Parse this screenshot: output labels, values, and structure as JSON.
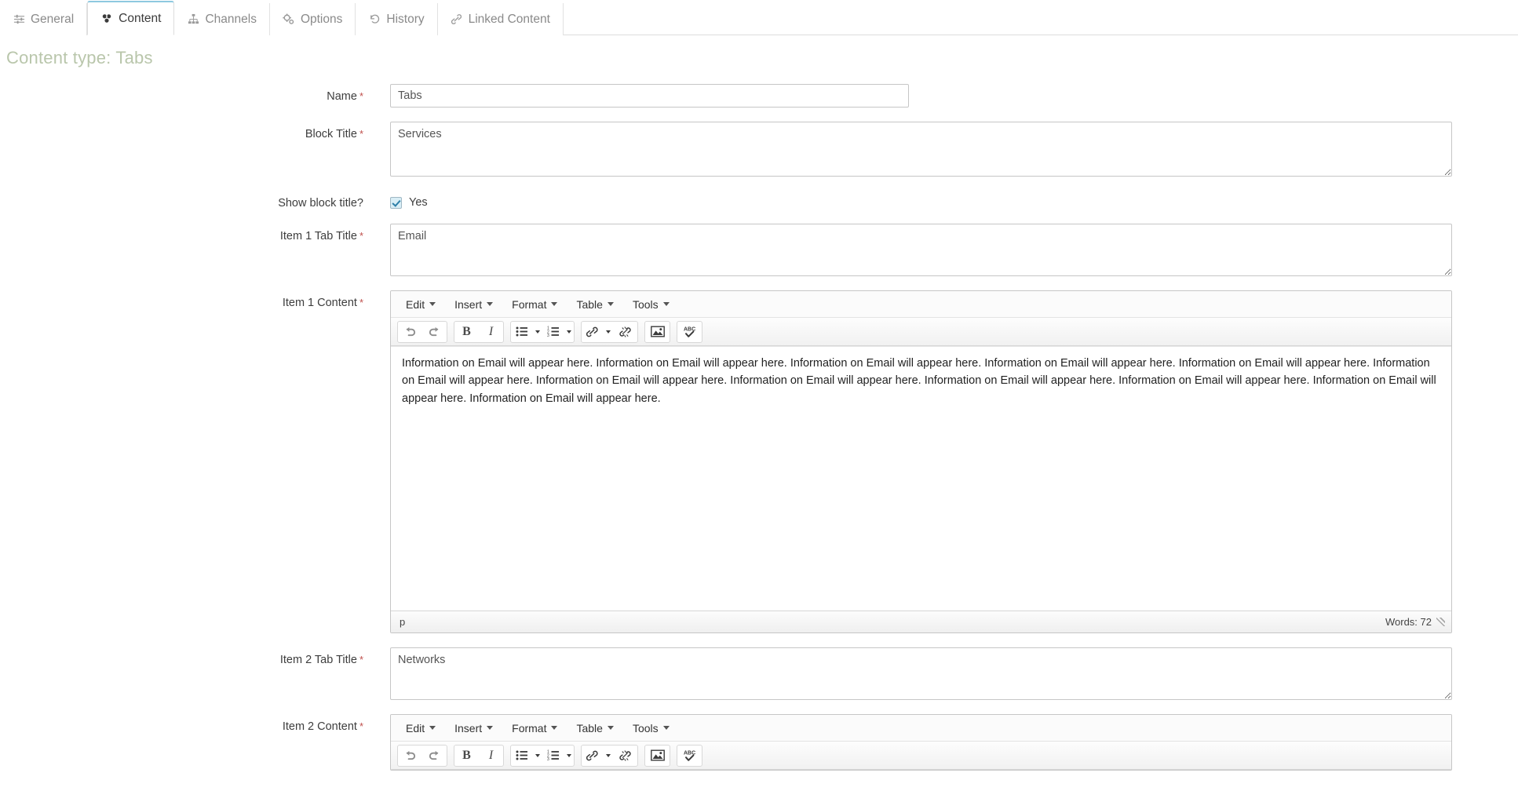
{
  "tabs": [
    {
      "label": "General",
      "icon": "sliders-icon",
      "active": false
    },
    {
      "label": "Content",
      "icon": "blocks-icon",
      "active": true
    },
    {
      "label": "Channels",
      "icon": "sitemap-icon",
      "active": false
    },
    {
      "label": "Options",
      "icon": "gears-icon",
      "active": false
    },
    {
      "label": "History",
      "icon": "undo-clock-icon",
      "active": false
    },
    {
      "label": "Linked Content",
      "icon": "link-chain-icon",
      "active": false
    }
  ],
  "page": {
    "title": "Content type: Tabs",
    "title_color": "#b9c6ab",
    "required_marker": "*",
    "required_color": "#c0504d"
  },
  "fields": {
    "name": {
      "label": "Name",
      "required": true,
      "value": "Tabs",
      "placeholder": ""
    },
    "block_title": {
      "label": "Block Title",
      "required": true,
      "value": "Services",
      "placeholder": ""
    },
    "show_block_title": {
      "label": "Show block title?",
      "checkbox_label": "Yes",
      "checked": true
    },
    "item1_tab_title": {
      "label": "Item 1 Tab Title",
      "required": true,
      "value": "Email",
      "placeholder": ""
    },
    "item1_content": {
      "label": "Item 1 Content",
      "required": true,
      "body": "Information on Email will appear here. Information on Email will appear here. Information on Email will appear here. Information on Email will appear here. Information on Email will appear here. Information on Email will appear here. Information on Email will appear here. Information on Email will appear here. Information on Email will appear here. Information on Email will appear here. Information on Email will appear here. Information on Email will appear here.",
      "status_path": "p",
      "word_count": "Words: 72"
    },
    "item2_tab_title": {
      "label": "Item 2 Tab Title",
      "required": true,
      "value": "Networks",
      "placeholder": ""
    },
    "item2_content": {
      "label": "Item 2 Content",
      "required": true
    }
  },
  "editor": {
    "menu": [
      {
        "label": "Edit"
      },
      {
        "label": "Insert"
      },
      {
        "label": "Format"
      },
      {
        "label": "Table"
      },
      {
        "label": "Tools"
      }
    ],
    "toolbar": [
      {
        "name": "undo-icon",
        "title": "Undo"
      },
      {
        "name": "redo-icon",
        "title": "Redo"
      },
      {
        "name": "bold-icon",
        "title": "Bold"
      },
      {
        "name": "italic-icon",
        "title": "Italic"
      },
      {
        "name": "bullet-list-icon",
        "title": "Bullet list"
      },
      {
        "name": "numbered-list-icon",
        "title": "Numbered list"
      },
      {
        "name": "link-icon",
        "title": "Insert/edit link"
      },
      {
        "name": "unlink-icon",
        "title": "Remove link"
      },
      {
        "name": "image-icon",
        "title": "Insert/edit image"
      },
      {
        "name": "spellcheck-icon",
        "title": "Spellcheck"
      }
    ]
  }
}
